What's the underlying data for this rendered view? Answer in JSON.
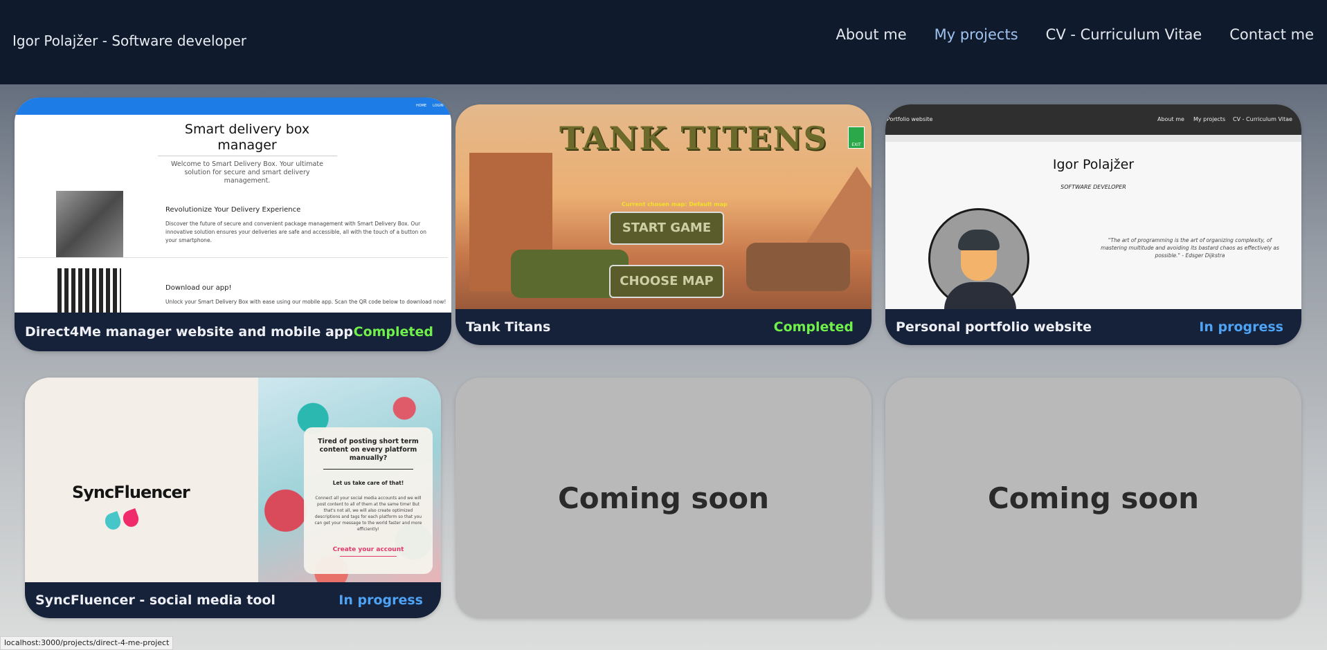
{
  "brand": "Igor Polajžer - Software developer",
  "nav": [
    "About me",
    "My projects",
    "CV - Curriculum Vitae",
    "Contact me"
  ],
  "active_nav": "My projects",
  "colors": {
    "navbar": "#0f1b2c",
    "footer": "#16213a",
    "completed": "#6ff04a",
    "in_progress": "#4ea3f5",
    "coming_soon_bg": "#b9b9b9"
  },
  "projects": [
    {
      "title": "Direct4Me manager website and mobile app",
      "status": "Completed",
      "preview": {
        "nav_items": [
          "HOME",
          "LOGIN"
        ],
        "heading": "Smart delivery box manager",
        "intro": "Welcome to Smart Delivery Box. Your ultimate solution for secure and smart delivery management.",
        "section1_title": "Revolutionize Your Delivery Experience",
        "section1_text": "Discover the future of secure and convenient package management with Smart Delivery Box. Our innovative solution ensures your deliveries are safe and accessible, all with the touch of a button on your smartphone.",
        "section2_title": "Download our app!",
        "section2_text": "Unlock your Smart Delivery Box with ease using our mobile app. Scan the QR code below to download now!"
      }
    },
    {
      "title": "Tank Titans",
      "status": "Completed",
      "preview": {
        "logo": "TANK TITENS",
        "current_map": "Current chosen map: Default map",
        "start_button": "START GAME",
        "map_button": "CHOOSE MAP",
        "exit_label": "EXIT"
      }
    },
    {
      "title": "Personal portfolio website",
      "status": "In progress",
      "preview": {
        "site_label": "Portfolio website",
        "nav_items": [
          "About me",
          "My projects",
          "CV - Curriculum Vitae"
        ],
        "name": "Igor Polajžer",
        "role": "SOFTWARE DEVELOPER",
        "quote": "\"The art of programming is the art of organizing complexity, of mastering multitude and avoiding its bastard chaos as effectively as possible.\" - Edsger Dijkstra"
      }
    },
    {
      "title": "SyncFluencer - social media tool",
      "status": "In progress",
      "preview": {
        "logo": "SyncFluencer",
        "heading": "Tired of posting short term content on every platform manually?",
        "subheading": "Let us take care of that!",
        "text": "Connect all your social media accounts and we will post content to all of them at the same time! But that's not all, we will also create optimized descriptions and tags for each platform so that you can get your message to the world faster and more efficiently!",
        "cta": "Create your account"
      }
    }
  ],
  "coming_soon": [
    "Coming soon",
    "Coming soon"
  ],
  "status_url": "localhost:3000/projects/direct-4-me-project"
}
